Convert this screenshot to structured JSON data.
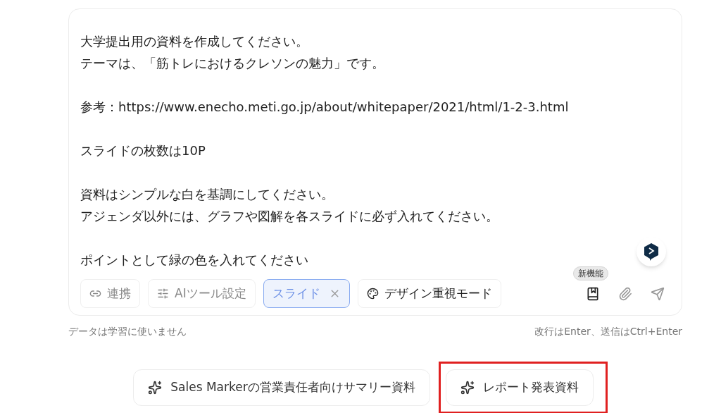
{
  "prompt": {
    "paragraphs": [
      [
        "大学提出用の資料を作成してください。",
        "テーマは、「筋トレにおけるクレソンの魅力」です。"
      ],
      [
        "参考：https://www.enecho.meti.go.jp/about/whitepaper/2021/html/1-2-3.html"
      ],
      [
        "スライドの枚数は10P"
      ],
      [
        "資料はシンプルな白を基調にしてください。",
        "アジェンダ以外には、グラフや図解を各スライドに必ず入れてください。"
      ],
      [
        "ポイントとして緑の色を入れてください"
      ]
    ]
  },
  "chips": [
    {
      "kind": "link",
      "label": "連携",
      "selected": false
    },
    {
      "kind": "tools",
      "label": "AIツール設定",
      "selected": false
    },
    {
      "kind": "slide",
      "label": "スライド",
      "selected": true
    },
    {
      "kind": "design",
      "label": "デザイン重視モード",
      "selected": false
    }
  ],
  "new_badge": "新機能",
  "footer": {
    "left": "データは学習に使いません",
    "right": "改行はEnter、送信はCtrl+Enter"
  },
  "suggestions": [
    {
      "label": "Sales Markerの営業責任者向けサマリー資料",
      "highlighted": false
    },
    {
      "label": "レポート発表資料",
      "highlighted": true
    }
  ]
}
